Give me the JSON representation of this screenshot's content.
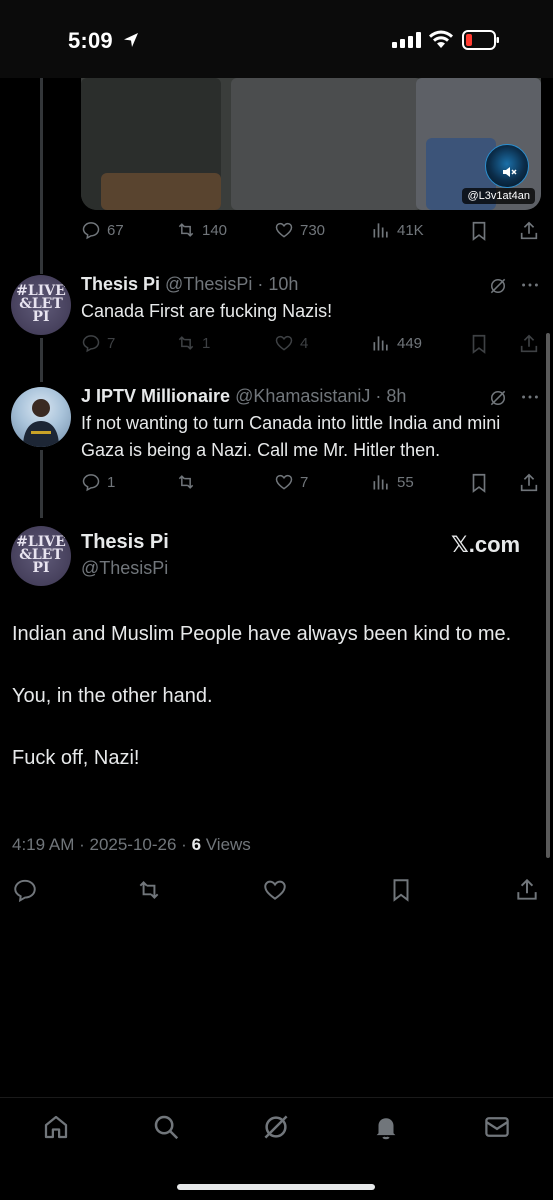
{
  "status_bar": {
    "time": "5:09",
    "icons": [
      "location-arrow-icon",
      "cellular-signal-icon",
      "wifi-icon",
      "battery-low-icon"
    ],
    "battery_color": "#ff3b30"
  },
  "prev_tweet": {
    "media": {
      "watermark": "@L3v1at4an",
      "icons": [
        "mute-icon"
      ]
    },
    "stats": {
      "replies": "67",
      "retweets": "140",
      "likes": "730",
      "views": "41K"
    }
  },
  "reply1": {
    "avatar_text": "#LIVE &LET PI",
    "name": "Thesis Pi",
    "handle": "@ThesisPi",
    "time": "10h",
    "text": "Canada First are fucking Nazis!",
    "stats": {
      "replies": "7",
      "retweets": "1",
      "likes": "4",
      "views": "449"
    }
  },
  "reply2": {
    "name": "J IPTV Millionaire",
    "handle": "@KhamasistaniJ",
    "time": "8h",
    "text": "If not wanting to turn Canada into little India and mini Gaza is being a Nazi. Call me Mr. Hitler then.",
    "stats": {
      "replies": "1",
      "retweets": "",
      "likes": "7",
      "views": "55"
    }
  },
  "main_tweet": {
    "name": "Thesis Pi",
    "handle": "@ThesisPi",
    "watermark": "𝕏.com",
    "paragraphs": [
      "Indian and Muslim People have always been kind to me.",
      "You, in the other hand.",
      "Fuck off, Nazi!"
    ],
    "time": "4:19 AM",
    "date": "2025-10-26",
    "views_count": "6",
    "views_label": "Views"
  },
  "tab_bar": {
    "tabs": [
      "home-icon",
      "search-icon",
      "grok-icon",
      "notifications-icon",
      "messages-icon"
    ]
  },
  "colors": {
    "background": "#000000",
    "text": "#e7e9ea",
    "muted": "#71767b",
    "divider": "#333639"
  }
}
